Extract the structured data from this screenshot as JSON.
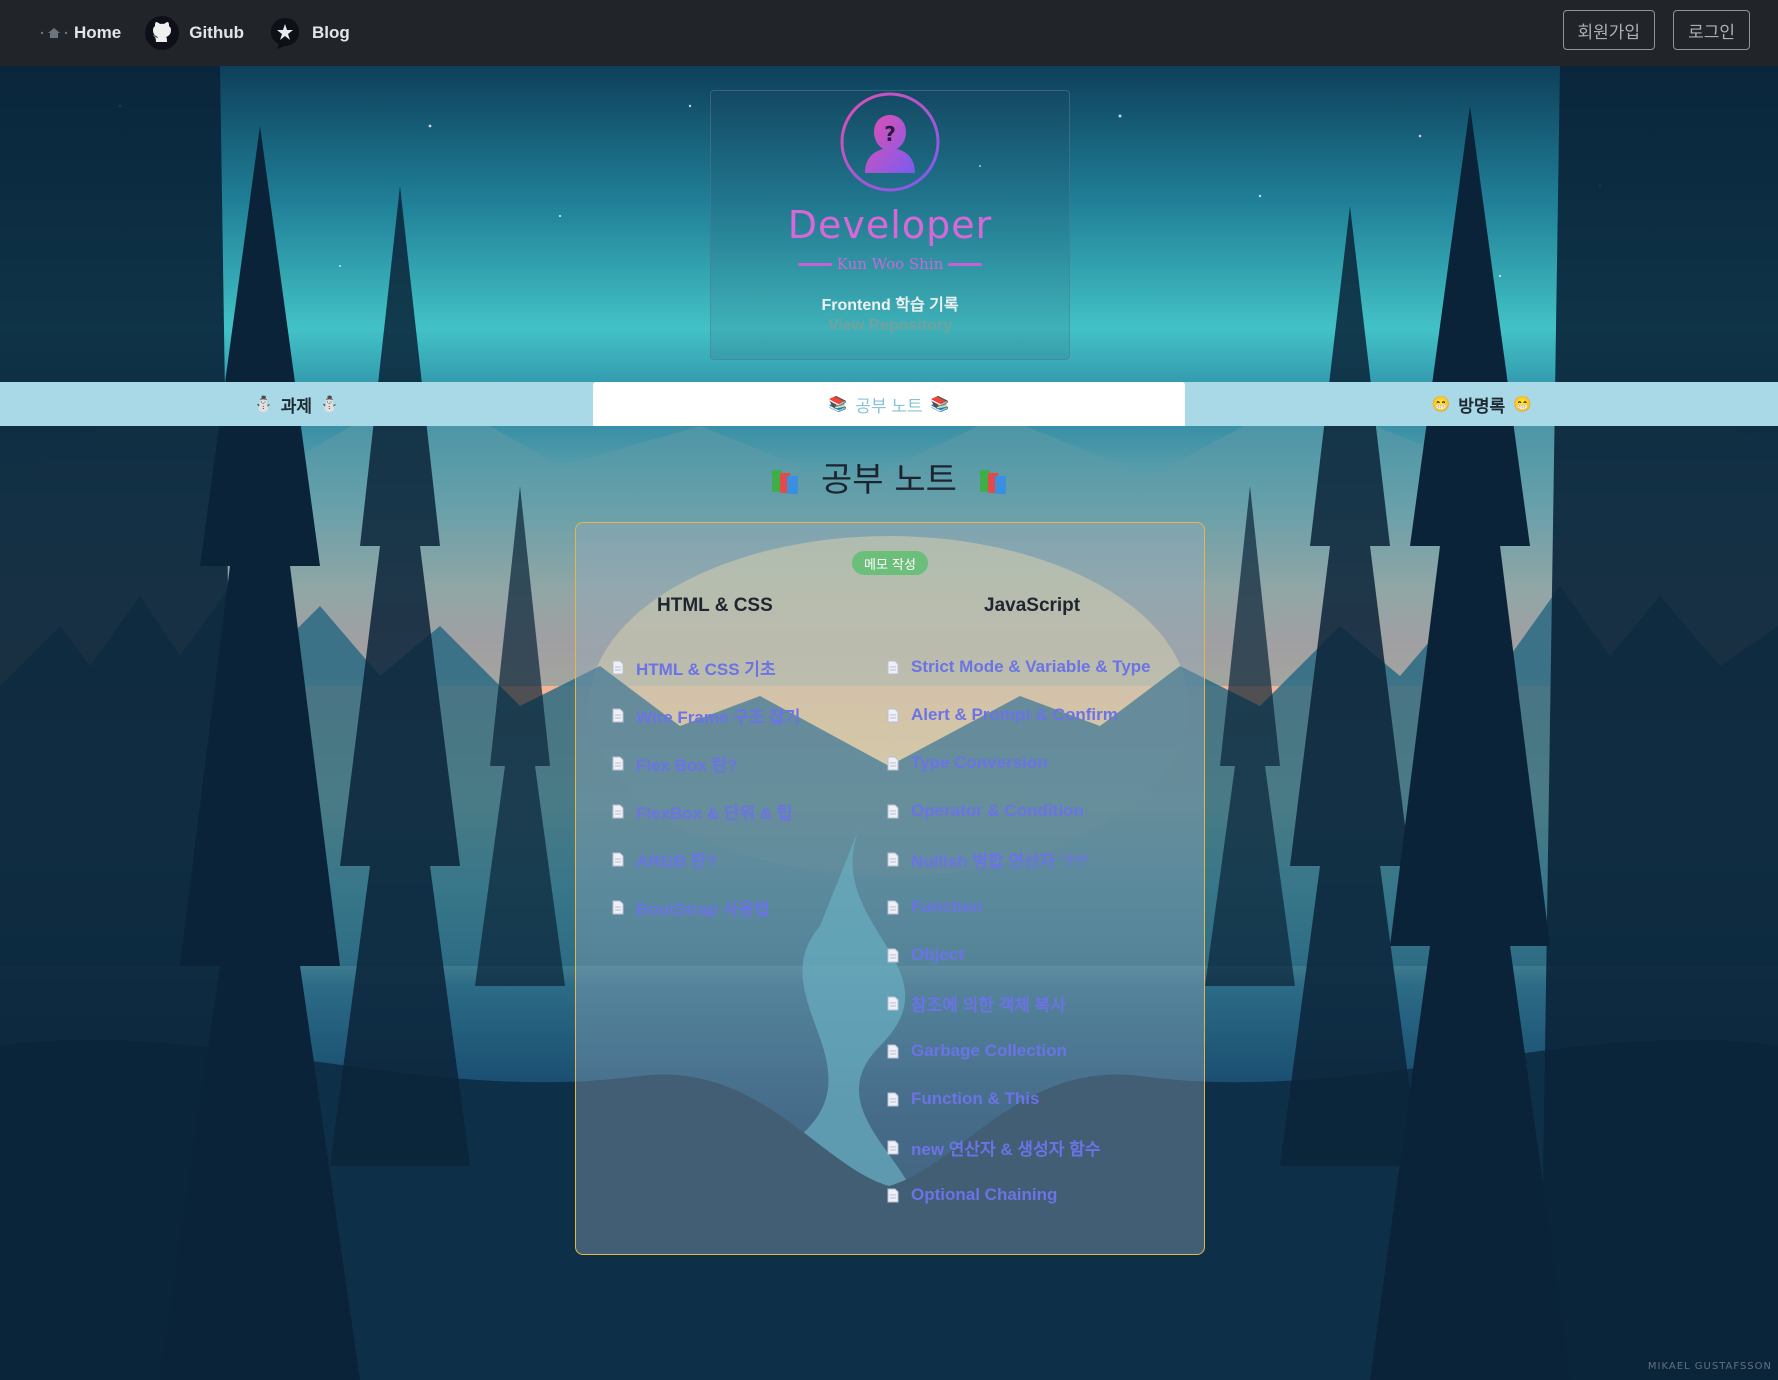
{
  "navbar": {
    "items": [
      {
        "label": "Home",
        "icon": "home-icon"
      },
      {
        "label": "Github",
        "icon": "github-icon"
      },
      {
        "label": "Blog",
        "icon": "blog-icon"
      }
    ],
    "signup_label": "회원가입",
    "login_label": "로그인"
  },
  "profile": {
    "title": "Developer",
    "subtitle": "Kun Woo Shin",
    "description": "Frontend 학습 기록",
    "link": "View Repository",
    "accent_color": "#c660d6"
  },
  "tabs": [
    {
      "label": "과제",
      "emoji": "⛄",
      "active": false
    },
    {
      "label": "공부 노트",
      "emoji": "📚",
      "active": true
    },
    {
      "label": "방명록",
      "emoji": "😁",
      "active": false
    }
  ],
  "section_title": "공부 노트",
  "memo_button": "메모 작성",
  "columns": [
    {
      "heading": "HTML & CSS",
      "items": [
        "HTML & CSS 기초",
        "Wire Frame 구조 잡기",
        "Flex Box 란?",
        "FlexBox & 단위 & 팁",
        "ARGB 란?",
        "BootStrap 사용법"
      ]
    },
    {
      "heading": "JavaScript",
      "items": [
        "Strict Mode & Variable & Type",
        "Alert & Prompt & Confirm",
        "Type Conversion",
        "Operator & Condition",
        "Nullish 병합 연산자 '??'",
        "Function",
        "Object",
        "참조에 의한 객체 복사",
        "Garbage Collection",
        "Function & This",
        "new 연산자 & 생성자 함수",
        "Optional Chaining"
      ]
    }
  ],
  "credit": "MIKAEL GUSTAFSSON",
  "colors": {
    "navbar_bg": "#212529",
    "tabbar_bg": "#a9d8e6",
    "link_color": "#6b73e6",
    "memo_green": "#6cbf7a",
    "notes_border": "#e5b64a"
  }
}
